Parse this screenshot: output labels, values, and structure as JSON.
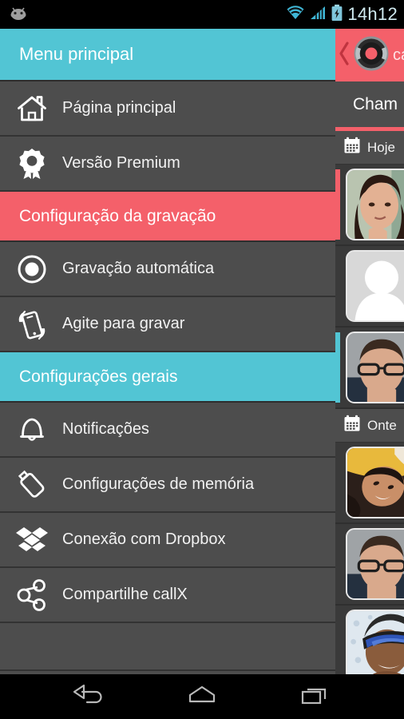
{
  "statusbar": {
    "clock": "14h12",
    "icons": [
      "android-robot-icon",
      "wifi-icon",
      "cellular-signal-icon",
      "battery-charging-icon"
    ]
  },
  "drawer": {
    "header": {
      "title": "Menu principal"
    },
    "items": [
      {
        "type": "item",
        "icon": "home-icon",
        "label": "Página principal"
      },
      {
        "type": "item",
        "icon": "medal-icon",
        "label": "Versão Premium"
      },
      {
        "type": "section",
        "style": "red",
        "label": "Configuração da gravação"
      },
      {
        "type": "item",
        "icon": "record-circle-icon",
        "label": "Gravação automática"
      },
      {
        "type": "item",
        "icon": "shake-phone-icon",
        "label": "Agite para gravar"
      },
      {
        "type": "section",
        "style": "cyan",
        "label": "Configurações gerais"
      },
      {
        "type": "item",
        "icon": "bell-icon",
        "label": "Notificações"
      },
      {
        "type": "item",
        "icon": "usb-drive-icon",
        "label": "Configurações de memória"
      },
      {
        "type": "item",
        "icon": "dropbox-icon",
        "label": "Conexão com Dropbox"
      },
      {
        "type": "item",
        "icon": "share-nodes-icon",
        "label": "Compartilhe callX"
      }
    ]
  },
  "content": {
    "actionbar": {
      "back_icon": "back-chevron-icon",
      "logo_icon": "callx-record-logo-icon",
      "app_name": "ca"
    },
    "tab": {
      "label": "Cham"
    },
    "groups": [
      {
        "date_icon": "calendar-icon",
        "date_label": "Hoje",
        "calls": [
          {
            "accent": "#f4606a",
            "photo": "woman-dark-hair-photo"
          },
          {
            "accent": "#3a3a3a",
            "photo": "default-avatar-placeholder"
          },
          {
            "accent": "#52c5d4",
            "photo": "man-glasses-photo"
          }
        ]
      },
      {
        "date_icon": "calendar-icon",
        "date_label": "Onte",
        "calls": [
          {
            "accent": "#3a3a3a",
            "photo": "person-yellow-hood-photo"
          },
          {
            "accent": "#3a3a3a",
            "photo": "man-glasses-photo-2"
          },
          {
            "accent": "#3a3a3a",
            "photo": "man-ski-goggles-photo"
          }
        ]
      }
    ]
  },
  "navbar": {
    "buttons": [
      {
        "icon": "back-arrow-icon",
        "label": "Back"
      },
      {
        "icon": "home-outline-icon",
        "label": "Home"
      },
      {
        "icon": "recents-icon",
        "label": "Recents"
      }
    ]
  },
  "colors": {
    "cyan": "#52c5d4",
    "red": "#f4606a",
    "drawer_bg": "#4d4d4d",
    "content_bg": "#3a3a3a"
  }
}
